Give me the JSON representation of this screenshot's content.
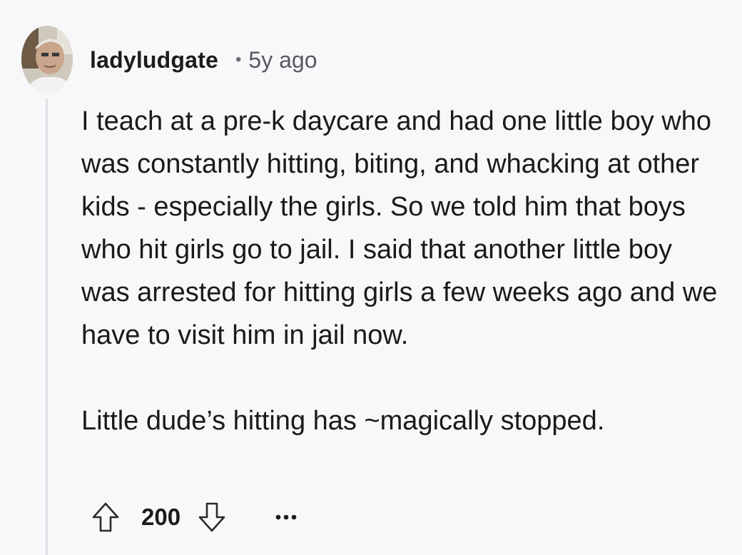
{
  "comment": {
    "username": "ladyludgate",
    "separator": "•",
    "timestamp": "5y ago",
    "avatar_icon": "user-avatar-photo",
    "paragraphs": [
      "I teach at a pre-k daycare and had one little boy who was constantly hitting, biting, and whacking at other kids - especially the girls. So we told him that boys who hit girls go to jail. I said that another little boy was arrested for hitting girls a few weeks ago and we have to visit him in jail now.",
      "Little dude’s hitting has ~magically stopped."
    ]
  },
  "actions": {
    "upvote_icon": "upvote-arrow-icon",
    "score": "200",
    "downvote_icon": "downvote-arrow-icon",
    "more_icon": "more-options-icon"
  },
  "colors": {
    "background": "#f8f8fa",
    "text": "#1a1a1b",
    "meta": "#55595e",
    "thread_line": "#dfe1e4"
  }
}
